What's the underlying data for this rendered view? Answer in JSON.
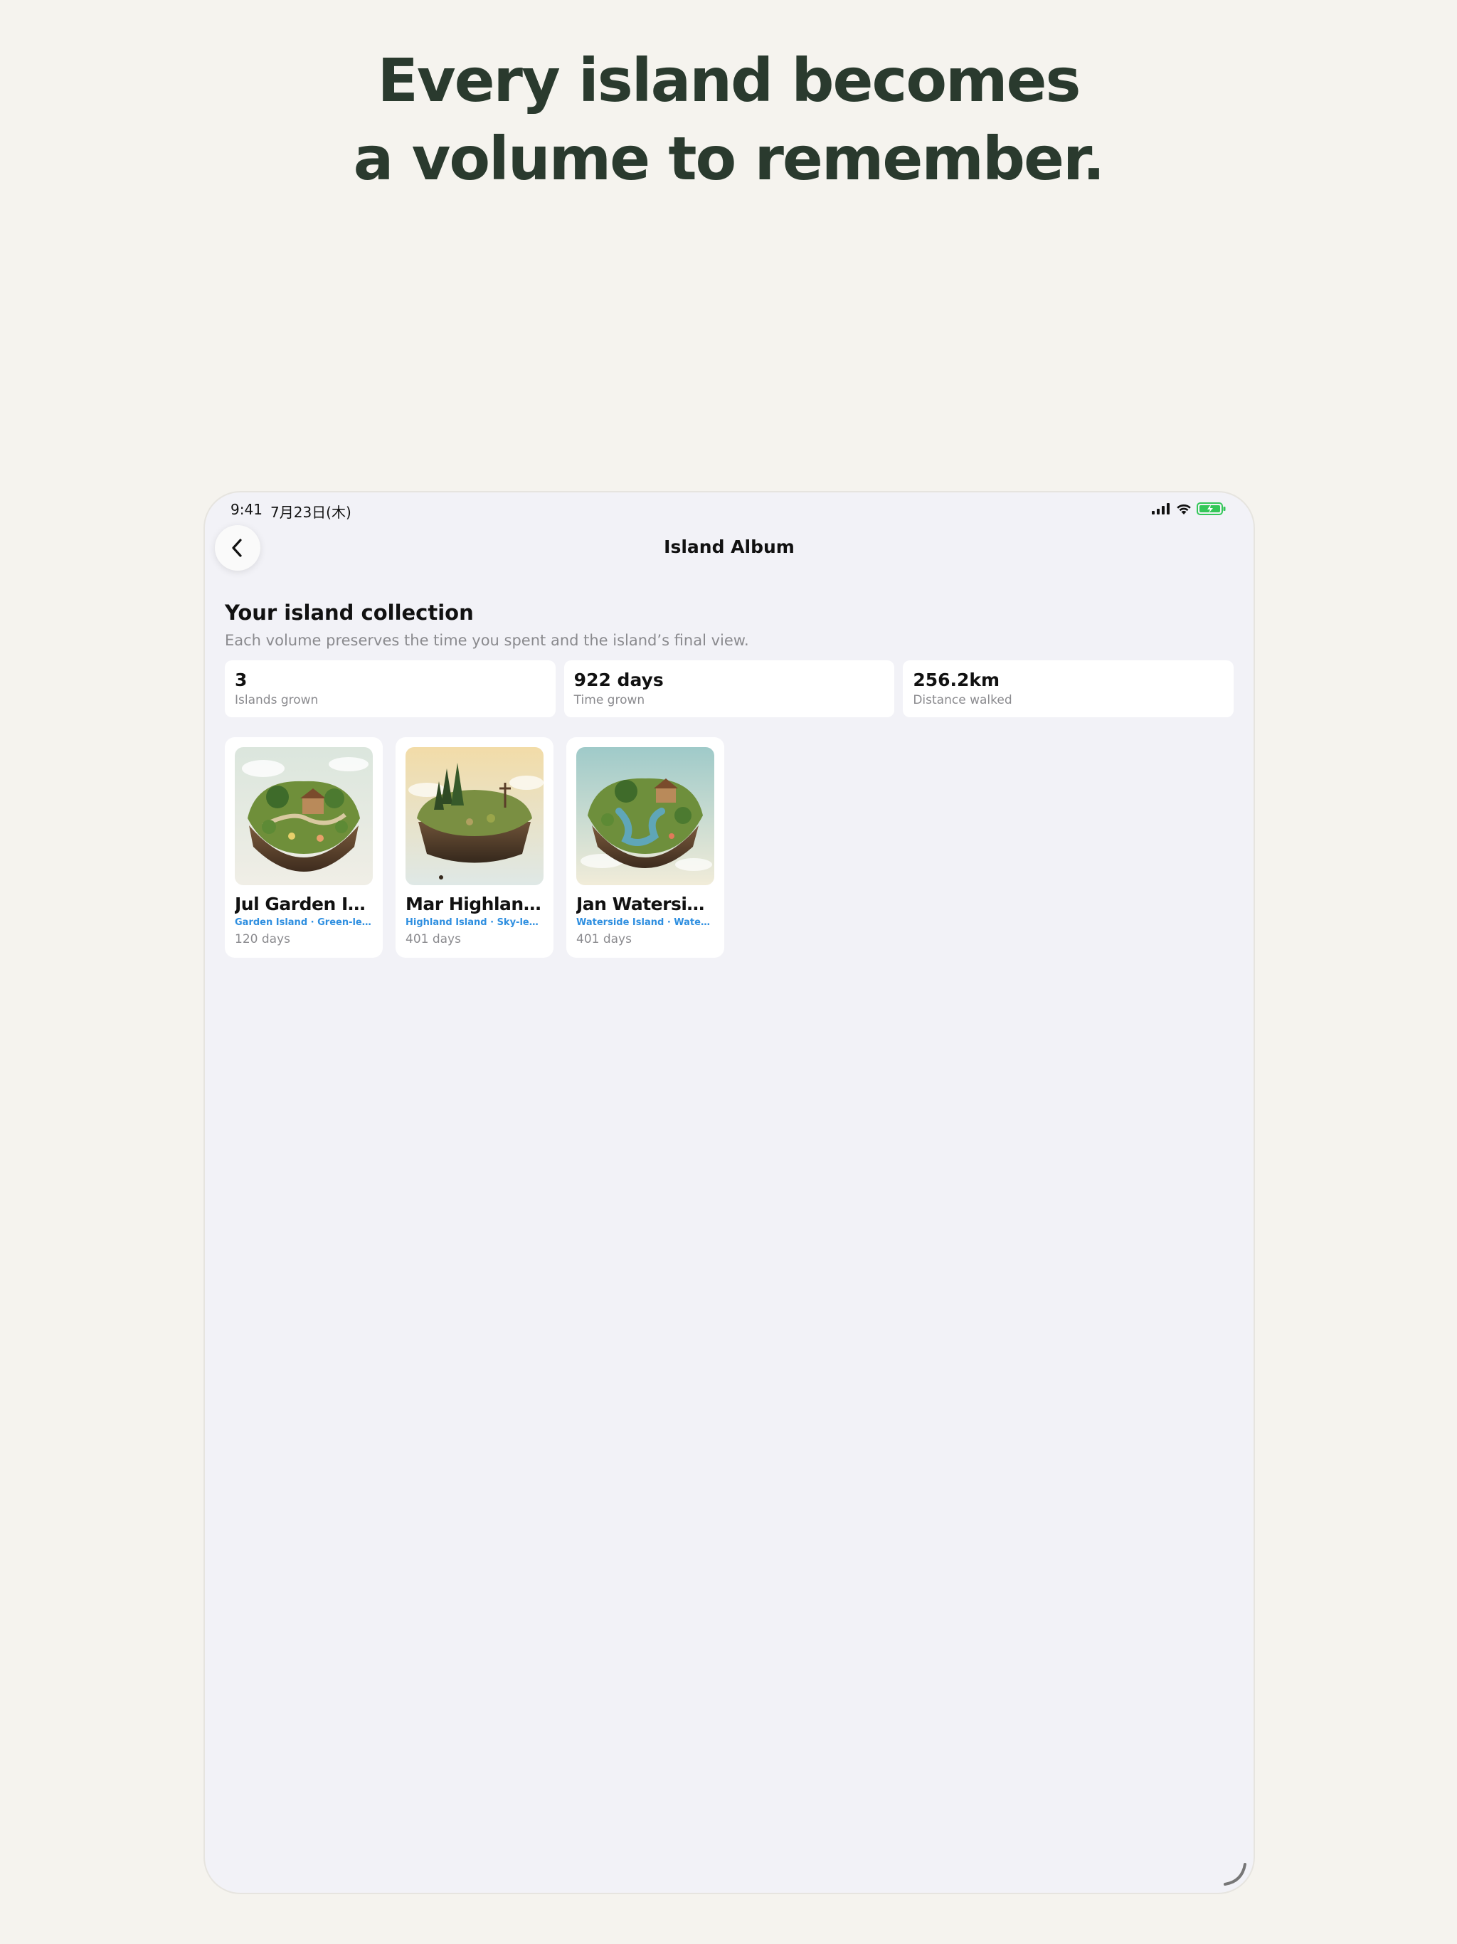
{
  "headline": {
    "line1": "Every island becomes",
    "line2": "a volume to remember."
  },
  "status_bar": {
    "time": "9:41",
    "date": "7月23日(木)",
    "icons": [
      "signal-icon",
      "wifi-icon",
      "battery-charging-icon"
    ],
    "battery_color": "#34c759"
  },
  "nav": {
    "back_icon": "chevron-left-icon",
    "title": "Island Album"
  },
  "collection": {
    "title": "Your island collection",
    "subtitle": "Each volume preserves the time you spent and the island’s final view."
  },
  "stats": [
    {
      "value": "3",
      "label": "Islands grown"
    },
    {
      "value": "922 days",
      "label": "Time grown"
    },
    {
      "value": "256.2km",
      "label": "Distance walked"
    }
  ],
  "islands": [
    {
      "title": "Jul Garden Isla...",
      "tags": "Garden Island · Green-led...",
      "days": "120 days",
      "image": "garden-island-illustration"
    },
    {
      "title": "Mar Highland I...",
      "tags": "Highland Island · Sky-led...",
      "days": "401 days",
      "image": "highland-island-illustration"
    },
    {
      "title": "Jan Waterside...",
      "tags": "Waterside Island · Water-l...",
      "days": "401 days",
      "image": "waterside-island-illustration"
    }
  ],
  "colors": {
    "background": "#f5f3ee",
    "headline": "#2a3a2e",
    "screen": "#f2f2f7",
    "tag_blue": "#2f8fe0"
  }
}
